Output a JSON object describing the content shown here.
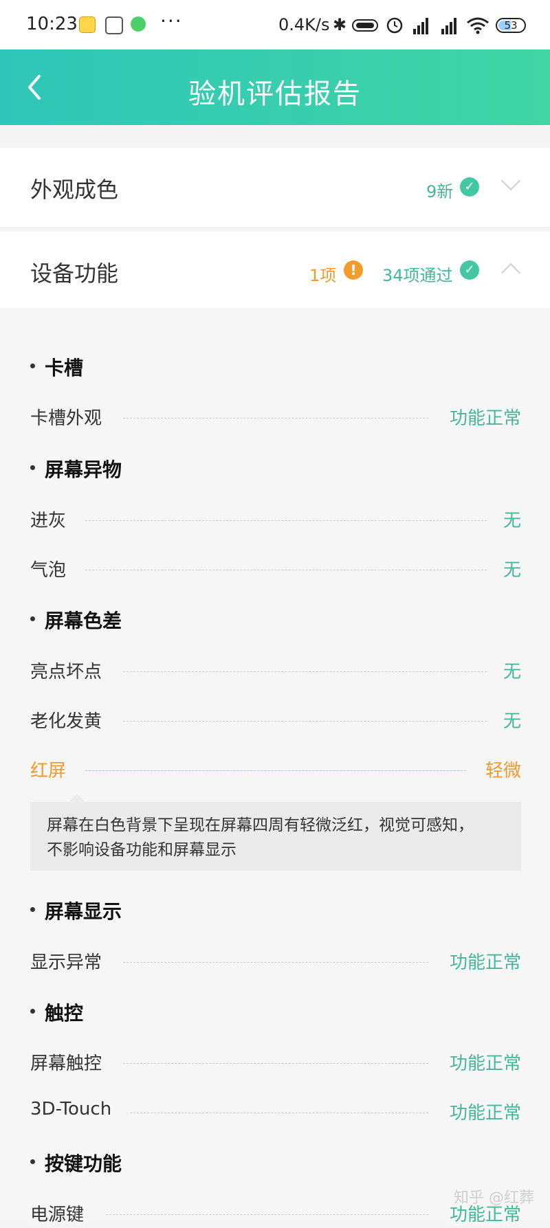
{
  "status_bar": {
    "time": "10:23",
    "more": "···",
    "net_speed": "0.4K/s",
    "battery": "53",
    "icons": [
      "app-icon-1",
      "app-icon-2",
      "app-icon-3",
      "bluetooth-icon",
      "toggle-icon",
      "alarm-icon",
      "signal-icon",
      "signal-icon",
      "wifi-icon",
      "battery-icon"
    ]
  },
  "header": {
    "title": "验机评估报告",
    "back_icon": "chevron-left-icon"
  },
  "sections": {
    "appearance": {
      "label": "外观成色",
      "value": "9新"
    },
    "function": {
      "label": "设备功能",
      "warn_value": "1项",
      "pass_value": "34项通过"
    }
  },
  "groups": {
    "card_slot": {
      "title": "卡槽",
      "items": [
        {
          "label": "卡槽外观",
          "value": "功能正常"
        }
      ]
    },
    "screen_foreign": {
      "title": "屏幕异物",
      "items": [
        {
          "label": "进灰",
          "value": "无"
        },
        {
          "label": "气泡",
          "value": "无"
        }
      ]
    },
    "screen_color": {
      "title": "屏幕色差",
      "items": [
        {
          "label": "亮点坏点",
          "value": "无"
        },
        {
          "label": "老化发黄",
          "value": "无"
        },
        {
          "label": "红屏",
          "value": "轻微"
        }
      ]
    },
    "screen_display": {
      "title": "屏幕显示",
      "items": [
        {
          "label": "显示异常",
          "value": "功能正常"
        }
      ]
    },
    "touch": {
      "title": "触控",
      "items": [
        {
          "label": "屏幕触控",
          "value": "功能正常"
        },
        {
          "label": "3D-Touch",
          "value": "功能正常"
        }
      ]
    },
    "keys": {
      "title": "按键功能",
      "items": [
        {
          "label": "电源键",
          "value": "功能正常"
        }
      ]
    }
  },
  "note": {
    "line1": "屏幕在白色背景下呈现在屏幕四周有轻微泛红，视觉可感知，",
    "line2": "不影响设备功能和屏幕显示"
  },
  "watermark": "知乎 @红葬",
  "colors": {
    "accent": "#44c7a3",
    "warning": "#ef9a2b",
    "header_start": "#2fc6b9",
    "header_end": "#40d5a3"
  }
}
